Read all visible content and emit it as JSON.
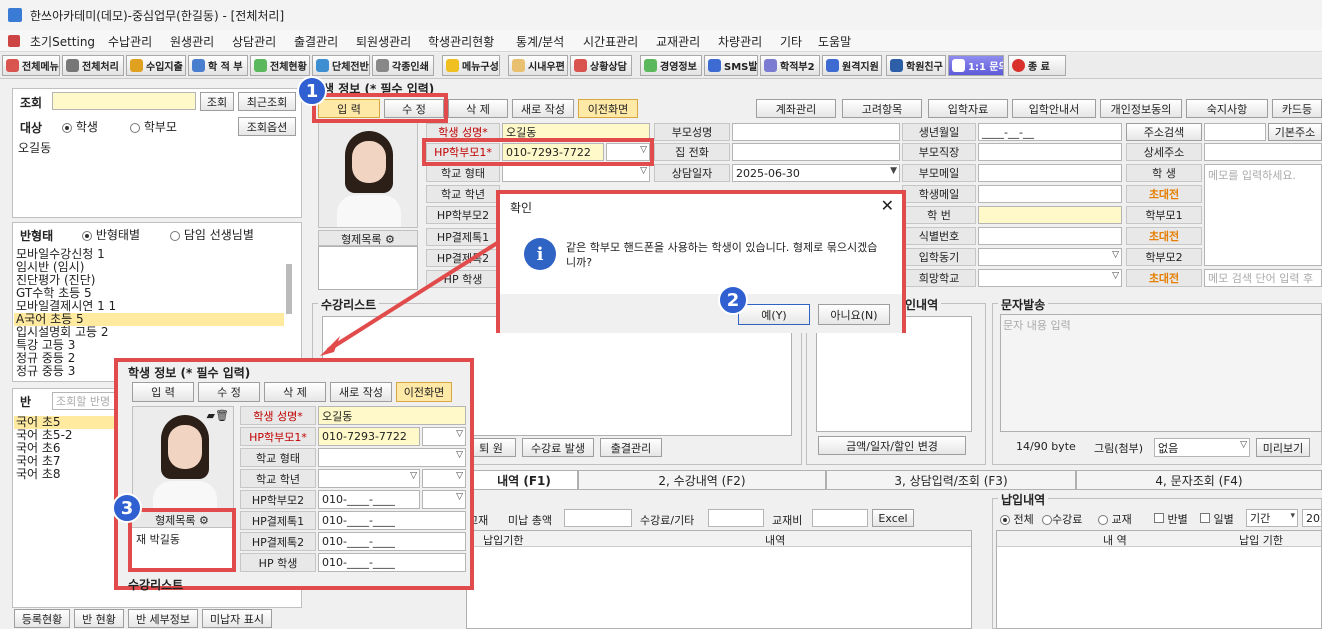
{
  "title": "한쓰아카테미(데모)-중심업무(한길동) - [전체처리]",
  "menu": [
    "초기Setting",
    "수납관리",
    "원생관리",
    "상담관리",
    "출결관리",
    "퇴원생관리",
    "학생관리현황",
    "통계/분석",
    "시간표관리",
    "교재관리",
    "차량관리",
    "기타",
    "도움말"
  ],
  "toolbar": [
    "전체메뉴",
    "전체처리",
    "수입지출",
    "학 적 부",
    "전체현황",
    "단체전반",
    "각종인쇄",
    "메뉴구성",
    "시내우편",
    "상황상담",
    "경영정보",
    "SMS발송",
    "학적부2",
    "원격지원",
    "학원친구",
    "1:1 문의",
    "종  료"
  ],
  "left": {
    "search_label": "조회",
    "search_btn": "조회",
    "recent_btn": "최근조회",
    "target_label": "대상",
    "opt_student": "학생",
    "opt_parent": "학부모",
    "search_options_btn": "조회옵션",
    "result": "오길동",
    "class_type_label": "반형태",
    "opt_by_class_type": "반형태별",
    "opt_by_teacher": "담임 선생님별",
    "class_types": [
      "모바일수강신청 1",
      "임시반 (임시)",
      "진단평가 (진단)",
      "GT수학 초등 5",
      "모바일결제시연 1 1",
      "A국어 초등 5",
      "입시설명회 고등 2",
      "특강 고등 3",
      "정규 중등 2",
      "정규 중등 3"
    ],
    "class_label": "반",
    "class_search_placeholder": "조회할 반명",
    "classes": [
      "국어 초5",
      "국어 초5-2",
      "국어 초6",
      "국어 초7",
      "국어 초8"
    ],
    "bottom_tabs": [
      "등록현황",
      "반 현황",
      "반 세부정보",
      "미납자 표시"
    ]
  },
  "student": {
    "section_title": "학생 정보 (* 필수 입력)",
    "tabs": [
      "입 력",
      "수 정",
      "삭 제",
      "새로 작성",
      "이전화면"
    ],
    "name_label": "학생 성명*",
    "name": "오길동",
    "hp_parent1_label": "HP학부모1*",
    "hp_parent1": "010-7293-7722",
    "school_type_label": "학교 형태",
    "school_grade_label": "학교 학년",
    "hp_parent2_label": "HP학부모2",
    "hp_parent2": "010-____-____",
    "hp_pay1_label": "HP결제톡1",
    "hp_pay1": "010-____-____",
    "hp_pay2_label": "HP결제톡2",
    "hp_pay2": "010-____-____",
    "hp_student_label": "HP   학생",
    "hp_student": "010-____-____",
    "hp_student_label_short": "HP   학생",
    "sibling_label": "형제목록",
    "sibling_item": "재 박길동"
  },
  "right_buttons": [
    "계좌관리",
    "고려항목",
    "입학자료",
    "입학안내서",
    "개인정보동의",
    "숙지사항",
    "카드등"
  ],
  "fields": {
    "parent_name": "부모성명",
    "home_phone": "집   전화",
    "consult_date": "상담일자",
    "consult_date_val": "2025-06-30",
    "birth": "생년월일",
    "birth_val": "____-__-__",
    "parent_job": "부모직장",
    "parent_email": "부모메일",
    "student_email": "학생메일",
    "student_no": "학   번",
    "id_no": "식별번호",
    "motive": "입학동기",
    "hope_school": "희망학교",
    "addr_search": "주소검색",
    "detail_addr": "상세주소",
    "student": "학  생",
    "invite": "초대전",
    "parent1": "학부모1",
    "parent2": "학부모2",
    "basic_addr": "기본주소",
    "memo_placeholder": "메모를 입력하세요.",
    "memo_search_placeholder": "메모 검색 단어 입력 후"
  },
  "course_list_title": "수강리스트",
  "bottom_buttons": {
    "withdraw": "퇴 원",
    "course_issue": "수강료 발생",
    "attendance": "출결관리",
    "amount_change": "금액/일자/할인 변경",
    "preview": "미리보기"
  },
  "sms": {
    "title": "문자발송",
    "placeholder": "문자 내용 입력",
    "bytes": "14/90 byte",
    "attach_label": "그림(첨부)",
    "attach_val": "없음"
  },
  "payment_detail_title": "납입내역",
  "bottom_tabs": [
    "내역 (F1)",
    "2, 수강내역 (F2)",
    "3, 상담입력/조회 (F3)",
    "4, 문자조회 (F4)"
  ],
  "payment": {
    "textbook": "교재",
    "unpaid_total": "미납 총액",
    "tuition_etc": "수강료/기타",
    "textbook_fee": "교재비",
    "excel": "Excel",
    "due_col": "납입기한",
    "detail_col": "내역"
  },
  "payment_right": {
    "title": "납입내역",
    "opt_all": "전체",
    "opt_tuition": "수강료",
    "opt_textbook": "교재",
    "chk_class": "반별",
    "chk_daily": "일별",
    "period": "기간",
    "year": "202",
    "col_detail": "내 역",
    "col_due": "납입 기한"
  },
  "dialog": {
    "title": "확인",
    "message": "같은 학부모 핸드폰을 사용하는 학생이 있습니다. 형제로 묶으시겠습니까?",
    "yes": "예(Y)",
    "no": "아니요(N)"
  },
  "badges": [
    "1",
    "2",
    "3"
  ],
  "colors": {
    "highlight_box": "#e24b4b",
    "badge": "#2f5fd0",
    "active_tab": "#ffe9a6",
    "required_label": "#c00000",
    "invite_label": "#e67e00"
  }
}
